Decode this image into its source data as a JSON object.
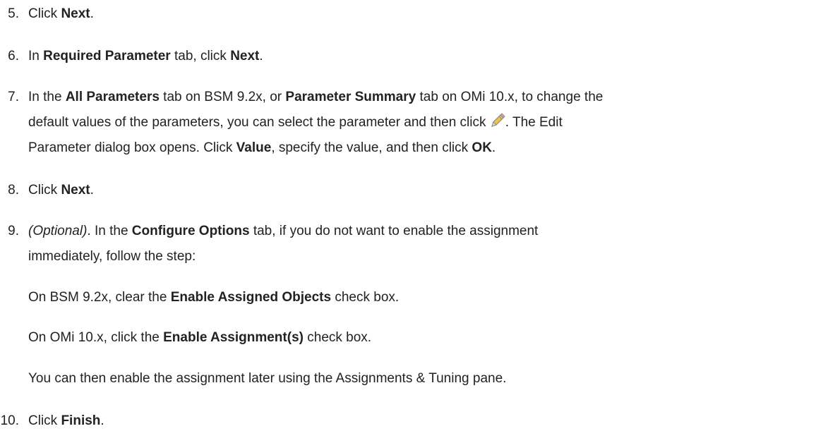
{
  "steps": [
    {
      "number": "5.",
      "parts": [
        [
          "Click ",
          ""
        ],
        [
          "Next",
          "b"
        ],
        [
          ".",
          ""
        ]
      ]
    },
    {
      "number": "6.",
      "parts": [
        [
          "In ",
          ""
        ],
        [
          "Required Parameter",
          "b"
        ],
        [
          " tab, click ",
          ""
        ],
        [
          "Next",
          "b"
        ],
        [
          ".",
          ""
        ]
      ]
    },
    {
      "number": "7.",
      "line1": [
        [
          "In the ",
          ""
        ],
        [
          "All Parameters",
          "b"
        ],
        [
          " tab on BSM 9.2x, or ",
          ""
        ],
        [
          "Parameter Summary",
          "b"
        ],
        [
          " tab on OMi 10.x, to change the",
          ""
        ]
      ],
      "line2_before_icon": "default values of the parameters, you can select the parameter and then click ",
      "icon": "pencil-edit-icon",
      "line2_after_icon": ". The Edit",
      "line3": [
        [
          "Parameter dialog box opens. Click ",
          ""
        ],
        [
          "Value",
          "b"
        ],
        [
          ", specify the value, and then click ",
          ""
        ],
        [
          "OK",
          "b"
        ],
        [
          ".",
          ""
        ]
      ]
    },
    {
      "number": "8.",
      "parts": [
        [
          "Click ",
          ""
        ],
        [
          "Next",
          "b"
        ],
        [
          ".",
          ""
        ]
      ]
    },
    {
      "number": "9.",
      "line1": [
        [
          "(Optional)",
          "i"
        ],
        [
          ". In the ",
          ""
        ],
        [
          "Configure Options",
          "b"
        ],
        [
          " tab, if you do not want to enable the assignment",
          ""
        ]
      ],
      "line2": [
        [
          "immediately, follow the step:",
          ""
        ]
      ],
      "sub1": [
        [
          "On BSM 9.2x, clear the ",
          ""
        ],
        [
          "Enable Assigned Objects",
          "b"
        ],
        [
          " check box.",
          ""
        ]
      ],
      "sub2": [
        [
          "On OMi 10.x, click the ",
          ""
        ],
        [
          "Enable Assignment(s)",
          "b"
        ],
        [
          " check box.",
          ""
        ]
      ],
      "sub3": [
        [
          "You can then enable the assignment later using the Assignments & Tuning pane.",
          ""
        ]
      ]
    },
    {
      "number": "10.",
      "parts": [
        [
          "Click ",
          ""
        ],
        [
          "Finish",
          "b"
        ],
        [
          ".",
          ""
        ]
      ]
    }
  ],
  "colors": {
    "text": "#222222",
    "pencil_body": "#f2c14e",
    "pencil_outline": "#8a8a8a"
  }
}
